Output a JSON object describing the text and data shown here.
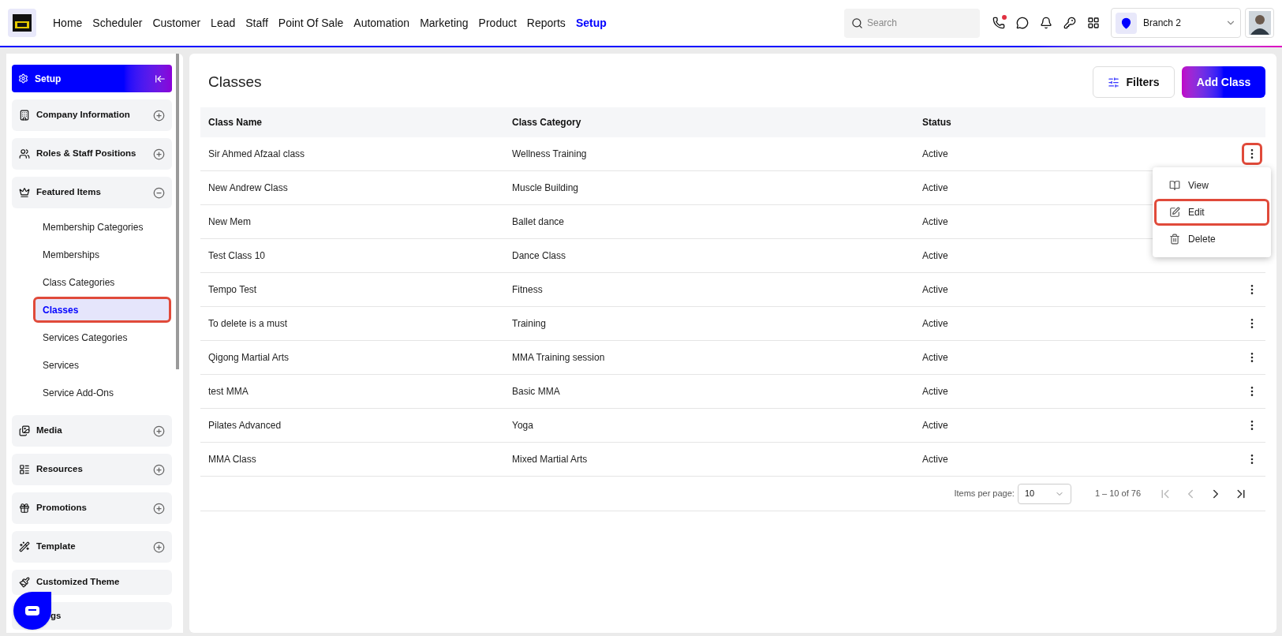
{
  "nav": {
    "items": [
      {
        "label": "Home",
        "selected": false
      },
      {
        "label": "Scheduler",
        "selected": false
      },
      {
        "label": "Customer",
        "selected": false
      },
      {
        "label": "Lead",
        "selected": false
      },
      {
        "label": "Staff",
        "selected": false
      },
      {
        "label": "Point Of Sale",
        "selected": false
      },
      {
        "label": "Automation",
        "selected": false
      },
      {
        "label": "Marketing",
        "selected": false
      },
      {
        "label": "Product",
        "selected": false
      },
      {
        "label": "Reports",
        "selected": false
      },
      {
        "label": "Setup",
        "selected": true
      }
    ],
    "search": {
      "placeholder": "Search"
    },
    "branch": "Branch 2"
  },
  "sidebar": {
    "title": "Setup",
    "sections": [
      {
        "label": "Company Information",
        "expanded": false
      },
      {
        "label": "Roles & Staff Positions",
        "expanded": false
      },
      {
        "label": "Featured Items",
        "expanded": true,
        "children": [
          {
            "label": "Membership Categories",
            "selected": false,
            "highlighted": false
          },
          {
            "label": "Memberships",
            "selected": false,
            "highlighted": false
          },
          {
            "label": "Class Categories",
            "selected": false,
            "highlighted": false
          },
          {
            "label": "Classes",
            "selected": true,
            "highlighted": true
          },
          {
            "label": "Services Categories",
            "selected": false,
            "highlighted": false
          },
          {
            "label": "Services",
            "selected": false,
            "highlighted": false
          },
          {
            "label": "Service Add-Ons",
            "selected": false,
            "highlighted": false
          }
        ]
      },
      {
        "label": "Media",
        "expanded": false
      },
      {
        "label": "Resources",
        "expanded": false
      },
      {
        "label": "Promotions",
        "expanded": false
      },
      {
        "label": "Template",
        "expanded": false
      },
      {
        "label": "Customized Theme"
      },
      {
        "label": "gs"
      }
    ]
  },
  "page": {
    "title": "Classes",
    "filters_button": "Filters",
    "add_button": "Add Class"
  },
  "table": {
    "columns": [
      "Class Name",
      "Class Category",
      "Status"
    ],
    "rows": [
      {
        "cells": [
          "Sir Ahmed Afzaal class",
          "Wellness Training",
          "Active"
        ],
        "menu_open": true
      },
      {
        "cells": [
          "New Andrew Class",
          "Muscle Building",
          "Active"
        ],
        "menu_open": false
      },
      {
        "cells": [
          "New Mem",
          "Ballet dance",
          "Active"
        ],
        "menu_open": false
      },
      {
        "cells": [
          "Test Class 10",
          "Dance Class",
          "Active"
        ],
        "menu_open": false
      },
      {
        "cells": [
          "Tempo Test",
          "Fitness",
          "Active"
        ],
        "menu_open": false
      },
      {
        "cells": [
          "To delete is a must",
          "Training",
          "Active"
        ],
        "menu_open": false
      },
      {
        "cells": [
          "Qigong Martial Arts",
          "MMA Training session",
          "Active"
        ],
        "menu_open": false
      },
      {
        "cells": [
          "test MMA",
          "Basic MMA",
          "Active"
        ],
        "menu_open": false
      },
      {
        "cells": [
          "Pilates Advanced",
          "Yoga",
          "Active"
        ],
        "menu_open": false
      },
      {
        "cells": [
          "MMA Class",
          "Mixed Martial Arts",
          "Active"
        ],
        "menu_open": false
      }
    ]
  },
  "row_menu": {
    "items": [
      {
        "label": "View",
        "kind": "view",
        "highlighted": false
      },
      {
        "label": "Edit",
        "kind": "edit",
        "highlighted": true
      },
      {
        "label": "Delete",
        "kind": "delete",
        "highlighted": false
      }
    ]
  },
  "pagination": {
    "label": "Items per page:",
    "page_size": "10",
    "range": "1 – 10 of 76"
  }
}
